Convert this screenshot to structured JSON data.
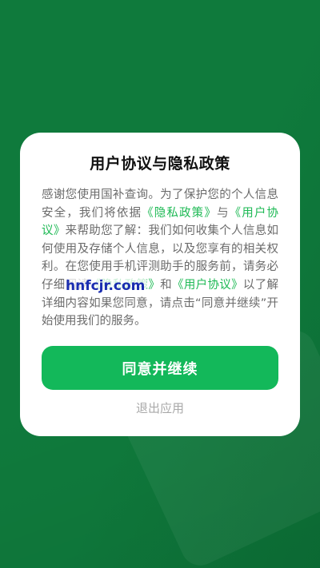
{
  "dialog": {
    "title": "用户协议与隐私政策",
    "text_1": "感谢您使用国补查询。为了保护您的个人信息安全，我们将依据",
    "link_privacy_1": "《隐私政策》",
    "text_2": "与",
    "link_user_1": "《用户协议》",
    "text_3": "来帮助您了解：我们如何收集个人信息如何使用及存储个人信息，以及您享有的相关权利。在您使用手机评测助手的服务前，请务必仔细阅读",
    "link_privacy_2": "《隐私政策》",
    "text_4": "和",
    "link_user_2": "《用户协议》",
    "text_5": "以了解详细内容如果您同意，请点击“同意并继续”开始使用我们的服务。",
    "agree_label": "同意并继续",
    "exit_label": "退出应用"
  },
  "watermark": "hnfcjr.com",
  "colors": {
    "background": "#0f7a3c",
    "accent": "#13b85a",
    "link": "#1db954"
  }
}
